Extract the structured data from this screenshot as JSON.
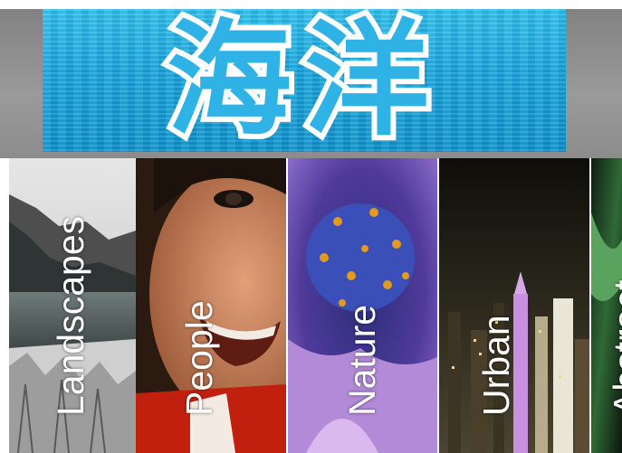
{
  "banner": {
    "title": "海洋"
  },
  "tiles": [
    {
      "label": "Landscapes"
    },
    {
      "label": "People"
    },
    {
      "label": "Nature"
    },
    {
      "label": "Urban"
    },
    {
      "label": "Abstract"
    }
  ]
}
